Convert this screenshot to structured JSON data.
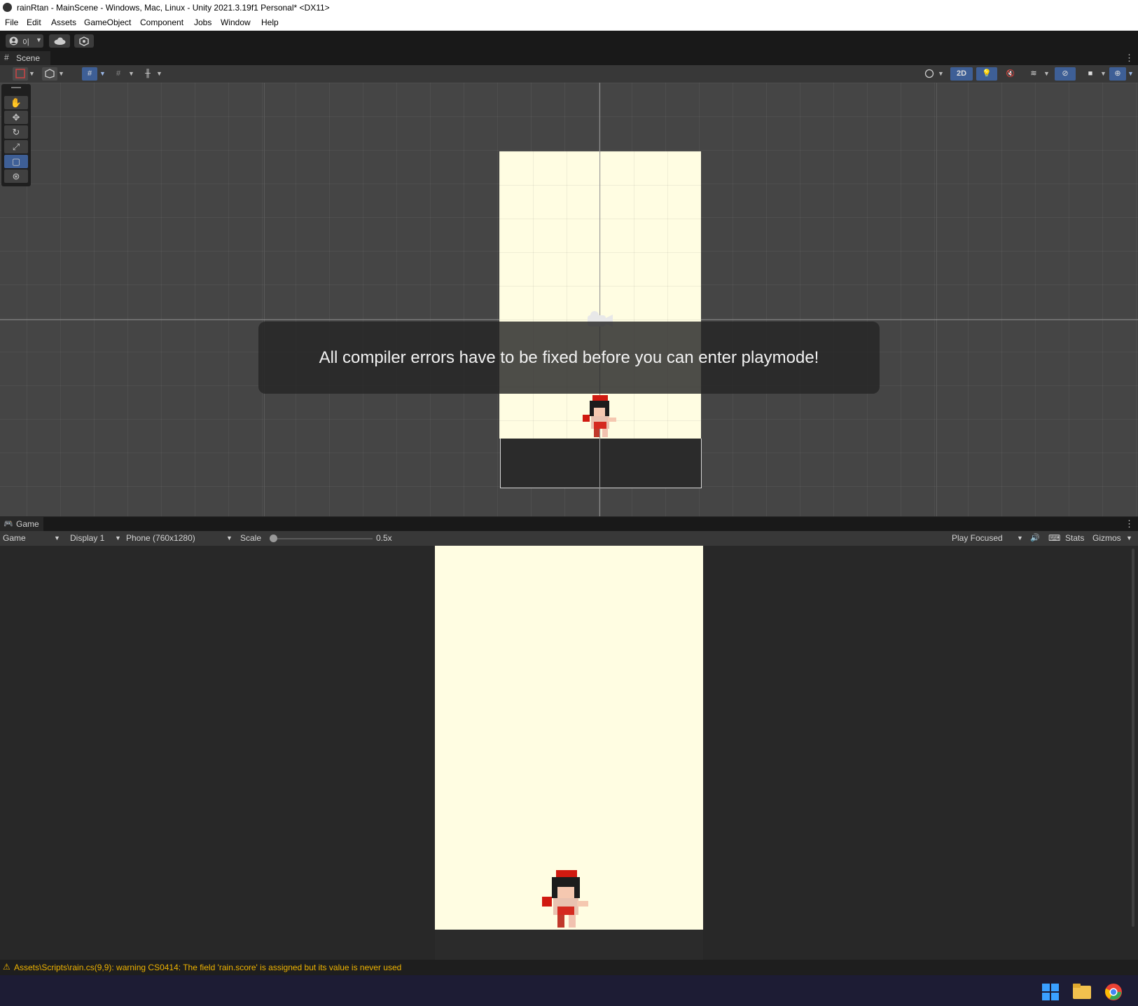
{
  "window": {
    "title": "rainRtan - MainScene - Windows, Mac, Linux - Unity 2021.3.19f1 Personal* <DX11>"
  },
  "menu": [
    "File",
    "Edit",
    "Assets",
    "GameObject",
    "Component",
    "Jobs",
    "Window",
    "Help"
  ],
  "toolbar": {
    "account_label": "이"
  },
  "scene": {
    "tab_label": "Scene",
    "toolbar": {
      "mode_2d": "2D"
    },
    "notification": "All compiler errors have to be fixed before you can enter playmode!"
  },
  "game": {
    "tab_label": "Game",
    "view_select": "Game",
    "display": "Display 1",
    "resolution": "Phone (760x1280)",
    "scale_label": "Scale",
    "scale_value": "0.5x",
    "scale_fraction": 0.0,
    "play_mode": "Play Focused",
    "stats_label": "Stats",
    "gizmos_label": "Gizmos"
  },
  "console": {
    "message": "Assets\\Scripts\\rain.cs(9,9): warning CS0414: The field 'rain.score' is assigned but its value is never used"
  },
  "colors": {
    "background_cream": "#fffde2",
    "accent_blue": "#3e5f96",
    "warning_yellow": "#f0b400"
  },
  "taskbar": {
    "icons": [
      "windows-start-icon",
      "file-explorer-icon",
      "chrome-icon"
    ]
  }
}
